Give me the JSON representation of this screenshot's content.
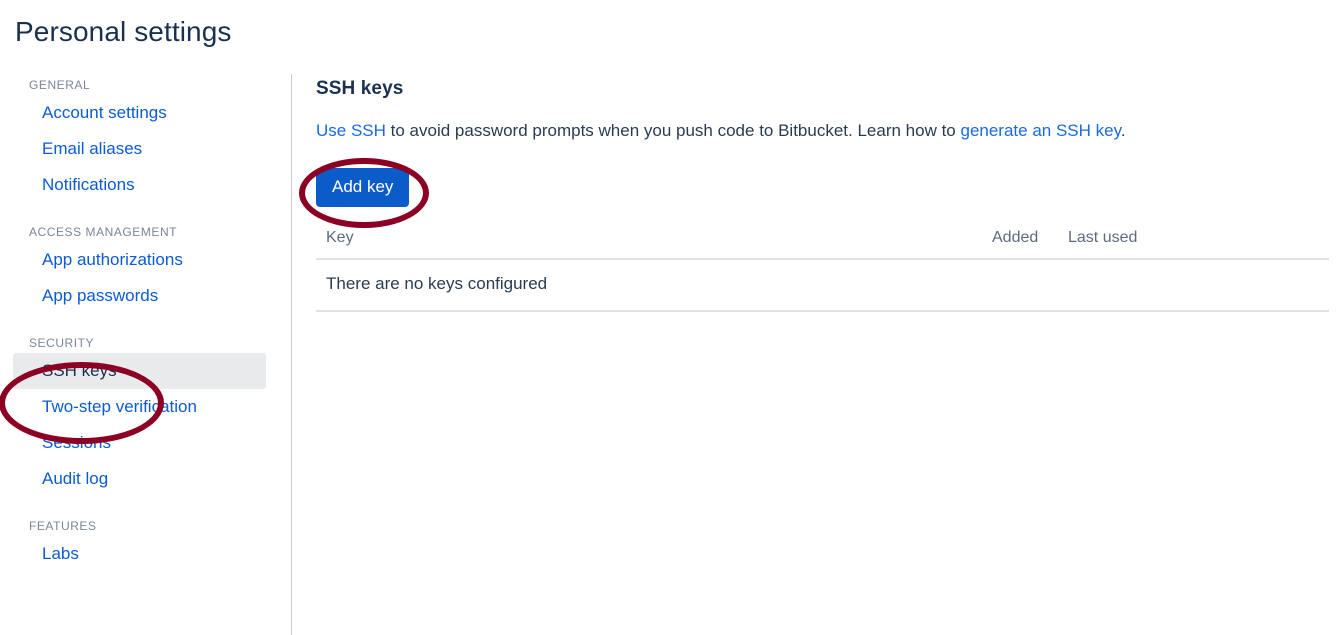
{
  "page": {
    "title": "Personal settings"
  },
  "sidebar": {
    "sections": [
      {
        "label": "GENERAL",
        "items": [
          {
            "label": "Account settings",
            "selected": false
          },
          {
            "label": "Email aliases",
            "selected": false
          },
          {
            "label": "Notifications",
            "selected": false
          }
        ]
      },
      {
        "label": "ACCESS MANAGEMENT",
        "items": [
          {
            "label": "App authorizations",
            "selected": false
          },
          {
            "label": "App passwords",
            "selected": false
          }
        ]
      },
      {
        "label": "SECURITY",
        "items": [
          {
            "label": "SSH keys",
            "selected": true
          },
          {
            "label": "Two-step verification",
            "selected": false
          },
          {
            "label": "Sessions",
            "selected": false
          },
          {
            "label": "Audit log",
            "selected": false
          }
        ]
      },
      {
        "label": "FEATURES",
        "items": [
          {
            "label": "Labs",
            "selected": false
          }
        ]
      }
    ]
  },
  "main": {
    "heading": "SSH keys",
    "description": {
      "link_use_ssh": "Use SSH",
      "text_middle": " to avoid password prompts when you push code to Bitbucket. Learn how to ",
      "link_generate": "generate an SSH key",
      "text_end": "."
    },
    "add_key_button": "Add key",
    "table": {
      "columns": [
        "Key",
        "Added",
        "Last used"
      ],
      "empty_message": "There are no keys configured",
      "rows": []
    }
  },
  "annotations": {
    "color": "#8b0023",
    "shapes": [
      {
        "name": "ellipse-add-key",
        "target": "Add key"
      },
      {
        "name": "ellipse-ssh-keys",
        "target": "SSH keys"
      }
    ]
  },
  "colors": {
    "accent_blue": "#0b5bc9",
    "link_blue": "#1a6ae0",
    "heading_navy": "#19314f",
    "selected_bg": "#e9eaec",
    "divider": "#dfe1e6",
    "annotation_red": "#8b0023"
  }
}
